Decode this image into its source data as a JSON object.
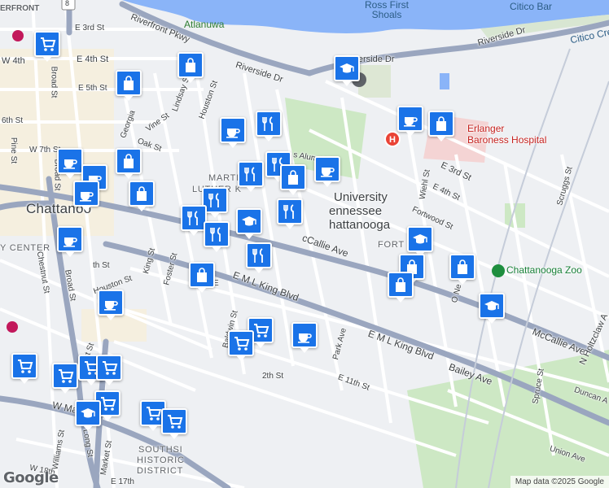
{
  "map": {
    "labels": {
      "riverfront": "ERFRONT",
      "atlanuwa": "Atlanuwa",
      "ross_shoals": "Ross First Shoals",
      "citico_bar": "Citico Bar",
      "citico_creek": "Citico Cre",
      "riverfront_pkwy": "Riverfront Pkwy",
      "riverside_dr_1": "Riverside Dr",
      "riverside_dr_2": "Riverside Dr",
      "riverside_dr_3": "Riverside Dr",
      "e_3rd_nw": "E 3rd St",
      "w_4th": "W 4th",
      "e_4th_nw": "E 4th St",
      "e_5th": "E 5th St",
      "sixth": "6th St",
      "w_7th": "W 7th St",
      "broad_st_1": "Broad St",
      "broad_st_2": "Broad St",
      "pine_st": "Pine St",
      "georgia": "Georgia",
      "vine_st": "Vine St",
      "lindsay": "Lindsay St",
      "houston_n": "Houston St",
      "oak_st": "Oak St",
      "alumni": "s Alumni D",
      "mlk_1": "MARTIN",
      "mlk_2": "LUTHER K",
      "chattanooga": "Chattanoo",
      "e_3rd_ne": "E 3rd St",
      "e_4th_ne": "E 4th St",
      "wiehl": "Wiehl St",
      "fortwood": "Fortwood St",
      "fort_wood": "FORT W",
      "scruggs": "Scruggs St",
      "erlanger_1": "Erlanger",
      "erlanger_2": "Baroness Hospital",
      "utc_1": "University",
      "utc_2": "ennessee",
      "utc_3": "hattanooga",
      "mccallie_w": "cCallie Ave",
      "mccallie_e": "McCallie Ave",
      "zoo": "Chattanooga Zoo",
      "center": "Y CENTER",
      "chestnut": "Chestnut St",
      "king_st": "King St",
      "foster": "Foster St",
      "houston_s": "Houston St",
      "broad_st_3": "Broad St",
      "th_st": "th St",
      "emlk_1": "E M L King Blvd",
      "emlk_2": "E M L King Blvd",
      "e_short": "E",
      "baldwin": "Baldwin St",
      "park_ave": "Park Ave",
      "e_11th": "E 11th St",
      "twelfth": "2th St",
      "bailey": "Bailey Ave",
      "o_ne": "O Ne",
      "holtzclaw": "N Holtzclaw A",
      "spruce": "Spruce St",
      "duncan": "Duncan A",
      "union": "Union Ave",
      "cowart": "Cowart St",
      "w_main": "W Main",
      "williams": "Williams St",
      "long_st": "Long St",
      "market": "Market St",
      "southside_1": "SOUTHSI",
      "southside_2": "HISTORIC",
      "southside_3": "DISTRICT",
      "w_18th": "W 18th",
      "e_17th": "E 17th",
      "route_8": "8"
    },
    "attribution": "Map data ©2025 Google",
    "logo": "Google"
  },
  "markers": [
    {
      "type": "shopping-cart",
      "icon": "shopping-cart-icon"
    },
    {
      "type": "shopping-bag",
      "icon": "shopping-bag-icon"
    },
    {
      "type": "shopping-bag",
      "icon": "shopping-bag-icon"
    },
    {
      "type": "school",
      "icon": "school-icon"
    },
    {
      "type": "cafe",
      "icon": "coffee-cup-icon"
    },
    {
      "type": "restaurant",
      "icon": "fork-knife-icon"
    },
    {
      "type": "cafe",
      "icon": "coffee-cup-icon"
    },
    {
      "type": "shopping-bag",
      "icon": "shopping-bag-icon"
    },
    {
      "type": "cafe",
      "icon": "coffee-cup-icon"
    },
    {
      "type": "shopping-bag",
      "icon": "shopping-bag-icon"
    },
    {
      "type": "cafe",
      "icon": "coffee-cup-icon"
    },
    {
      "type": "restaurant",
      "icon": "fork-knife-icon"
    },
    {
      "type": "restaurant",
      "icon": "fork-knife-icon"
    },
    {
      "type": "shopping-bag",
      "icon": "shopping-bag-icon"
    },
    {
      "type": "cafe",
      "icon": "coffee-cup-icon"
    },
    {
      "type": "shopping-bag",
      "icon": "shopping-bag-icon"
    },
    {
      "type": "restaurant",
      "icon": "fork-knife-icon"
    },
    {
      "type": "restaurant",
      "icon": "fork-knife-icon"
    },
    {
      "type": "restaurant",
      "icon": "fork-knife-icon"
    },
    {
      "type": "school",
      "icon": "school-icon"
    },
    {
      "type": "restaurant",
      "icon": "fork-knife-icon"
    },
    {
      "type": "cafe",
      "icon": "coffee-cup-icon"
    },
    {
      "type": "school",
      "icon": "school-icon"
    },
    {
      "type": "shopping-bag",
      "icon": "shopping-bag-icon"
    },
    {
      "type": "shopping-bag",
      "icon": "shopping-bag-icon"
    },
    {
      "type": "shopping-bag",
      "icon": "shopping-bag-icon"
    },
    {
      "type": "restaurant",
      "icon": "fork-knife-icon"
    },
    {
      "type": "shopping-bag",
      "icon": "shopping-bag-icon"
    },
    {
      "type": "cafe",
      "icon": "coffee-cup-icon"
    },
    {
      "type": "school",
      "icon": "school-icon"
    },
    {
      "type": "shopping-cart",
      "icon": "shopping-cart-icon"
    },
    {
      "type": "cafe",
      "icon": "coffee-cup-icon"
    },
    {
      "type": "shopping-cart",
      "icon": "shopping-cart-icon"
    },
    {
      "type": "shopping-cart",
      "icon": "shopping-cart-icon"
    },
    {
      "type": "shopping-cart",
      "icon": "shopping-cart-icon"
    },
    {
      "type": "shopping-cart",
      "icon": "shopping-cart-icon"
    },
    {
      "type": "shopping-cart",
      "icon": "shopping-cart-icon"
    },
    {
      "type": "shopping-cart",
      "icon": "shopping-cart-icon"
    },
    {
      "type": "school",
      "icon": "school-icon"
    },
    {
      "type": "shopping-cart",
      "icon": "shopping-cart-icon"
    },
    {
      "type": "shopping-cart",
      "icon": "shopping-cart-icon"
    },
    {
      "type": "cafe",
      "icon": "coffee-cup-icon"
    }
  ]
}
